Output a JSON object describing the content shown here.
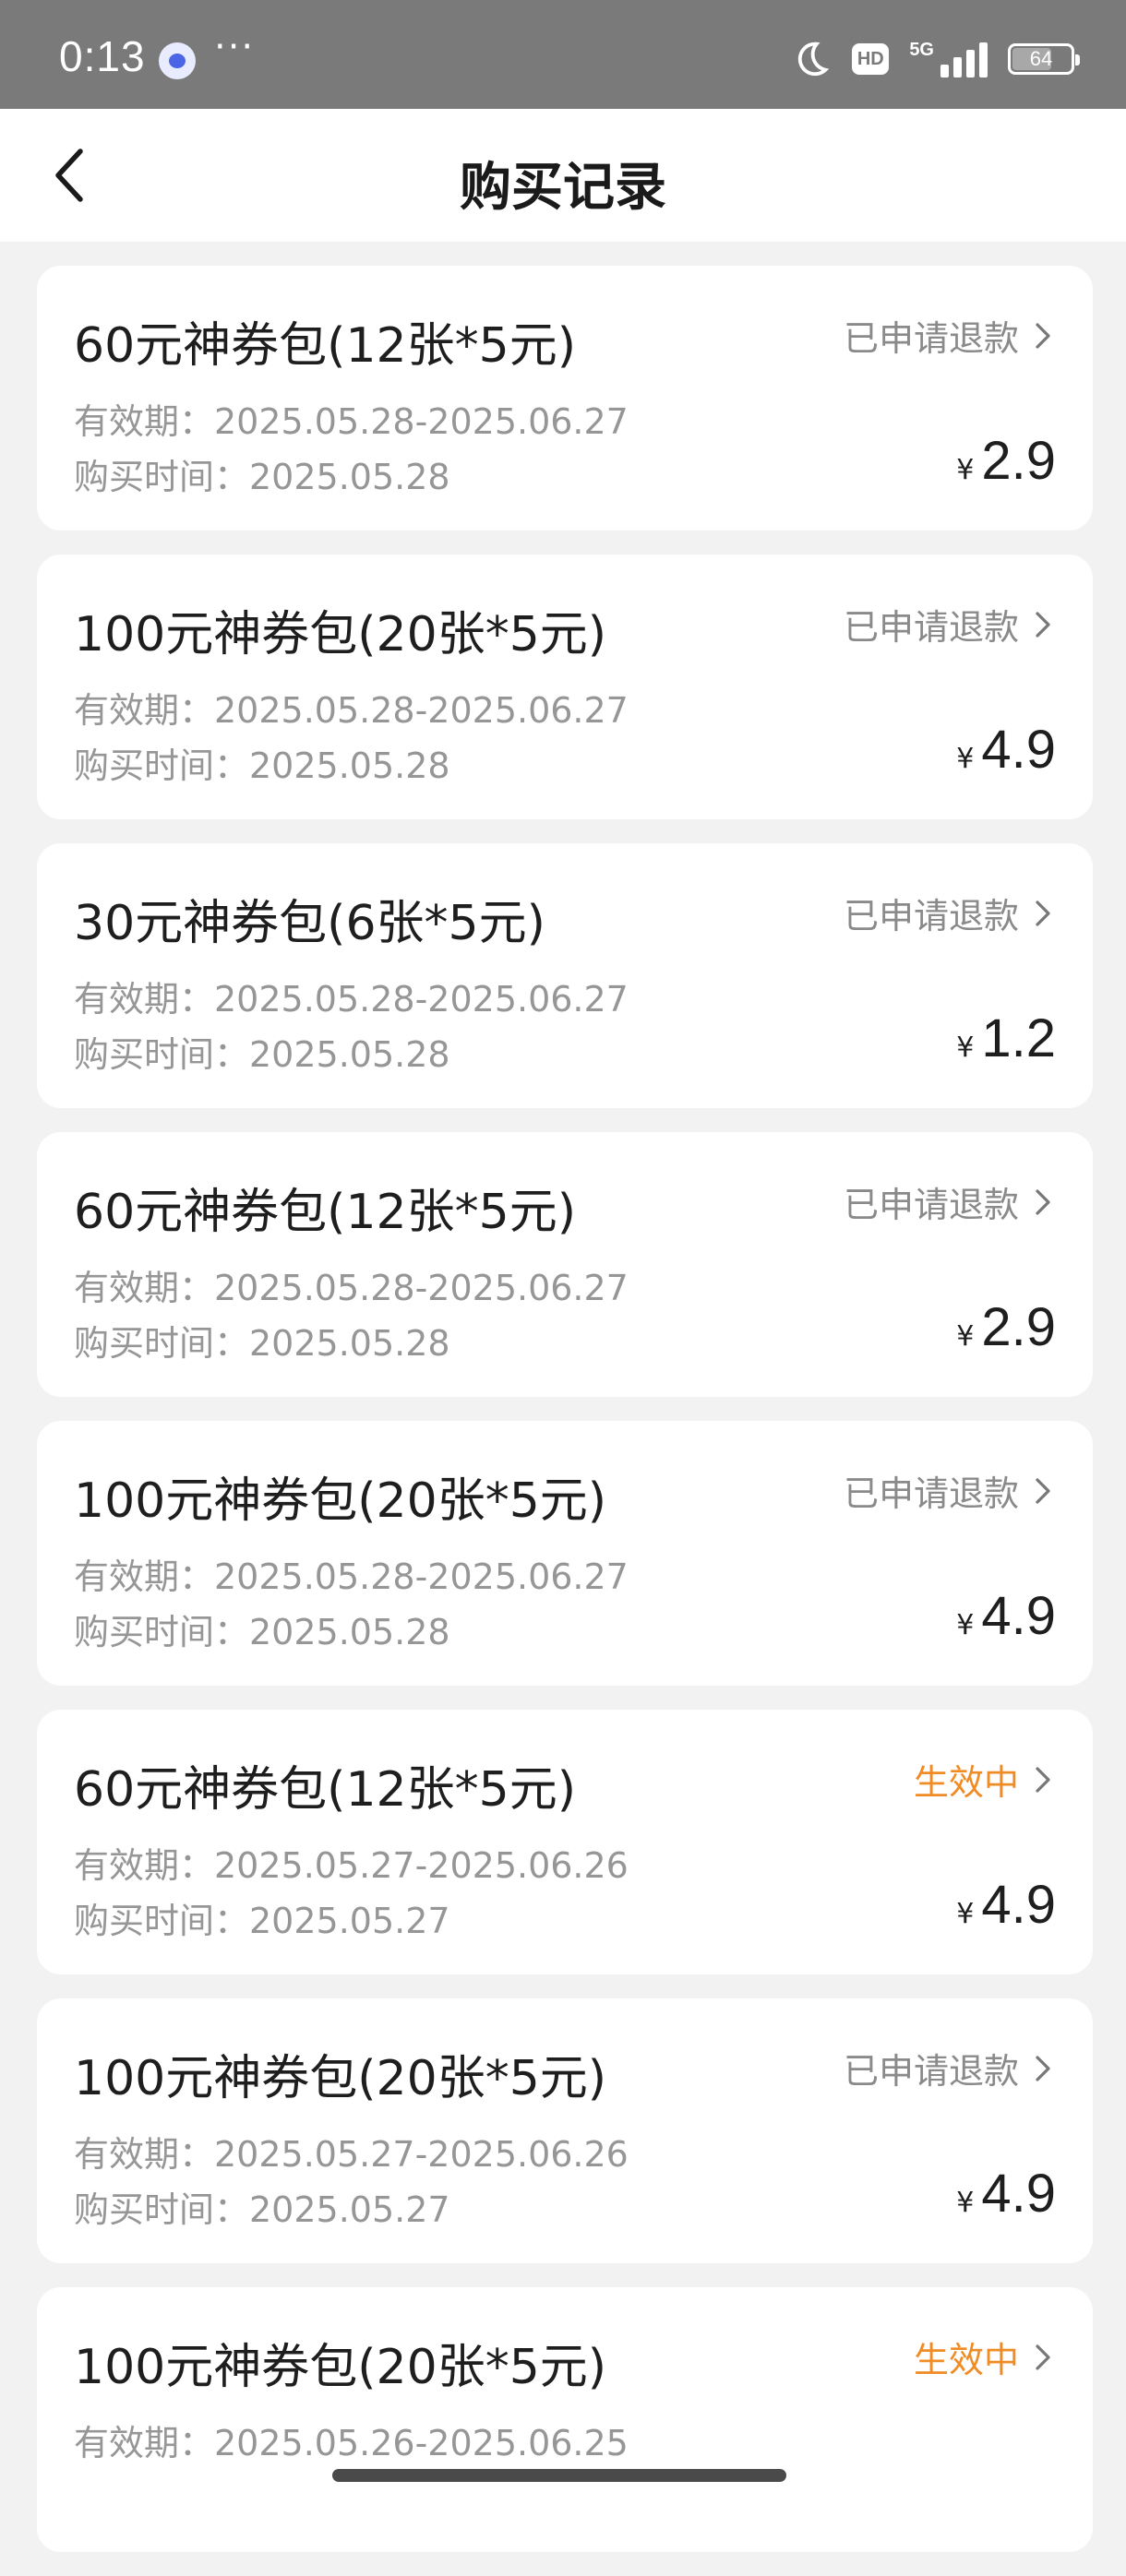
{
  "status_bar": {
    "time": "0:13",
    "more": "···",
    "network": "5G",
    "hd": "HD",
    "battery": "64"
  },
  "header": {
    "title": "购买记录",
    "back_icon": "chevron-left-icon"
  },
  "colors": {
    "status_refund": "#8a8a8a",
    "status_active": "#f08c25"
  },
  "records": [
    {
      "title": "60元神券包(12张*5元)",
      "status": "已申请退款",
      "status_type": "refund",
      "validity": "有效期：2025.05.28-2025.06.27",
      "purchase": "购买时间：2025.05.28",
      "currency": "¥",
      "price": "2.9"
    },
    {
      "title": "100元神券包(20张*5元)",
      "status": "已申请退款",
      "status_type": "refund",
      "validity": "有效期：2025.05.28-2025.06.27",
      "purchase": "购买时间：2025.05.28",
      "currency": "¥",
      "price": "4.9"
    },
    {
      "title": "30元神券包(6张*5元)",
      "status": "已申请退款",
      "status_type": "refund",
      "validity": "有效期：2025.05.28-2025.06.27",
      "purchase": "购买时间：2025.05.28",
      "currency": "¥",
      "price": "1.2"
    },
    {
      "title": "60元神券包(12张*5元)",
      "status": "已申请退款",
      "status_type": "refund",
      "validity": "有效期：2025.05.28-2025.06.27",
      "purchase": "购买时间：2025.05.28",
      "currency": "¥",
      "price": "2.9"
    },
    {
      "title": "100元神券包(20张*5元)",
      "status": "已申请退款",
      "status_type": "refund",
      "validity": "有效期：2025.05.28-2025.06.27",
      "purchase": "购买时间：2025.05.28",
      "currency": "¥",
      "price": "4.9"
    },
    {
      "title": "60元神券包(12张*5元)",
      "status": "生效中",
      "status_type": "active",
      "validity": "有效期：2025.05.27-2025.06.26",
      "purchase": "购买时间：2025.05.27",
      "currency": "¥",
      "price": "4.9"
    },
    {
      "title": "100元神券包(20张*5元)",
      "status": "已申请退款",
      "status_type": "refund",
      "validity": "有效期：2025.05.27-2025.06.26",
      "purchase": "购买时间：2025.05.27",
      "currency": "¥",
      "price": "4.9"
    },
    {
      "title": "100元神券包(20张*5元)",
      "status": "生效中",
      "status_type": "active",
      "validity": "有效期：2025.05.26-2025.06.25"
    }
  ]
}
